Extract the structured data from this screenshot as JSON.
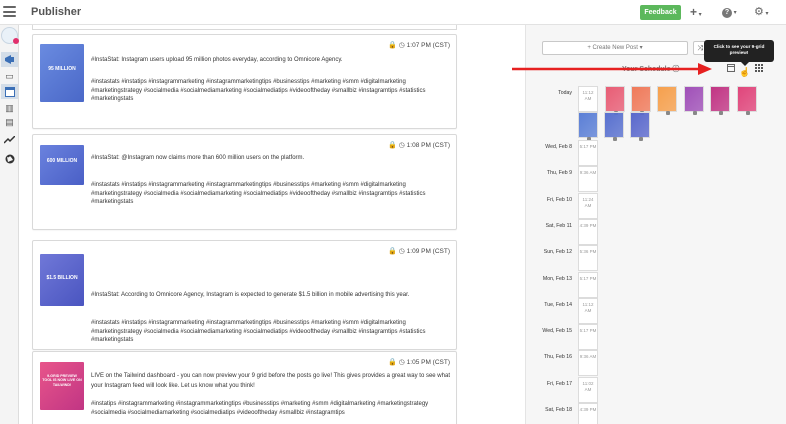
{
  "header": {
    "title": "Publisher",
    "feedback_label": "Feedback",
    "add_label": "+",
    "help_label": "?",
    "settings_label": "⚙"
  },
  "sidebar": {
    "items": [
      {
        "icon": "megaphone-icon"
      },
      {
        "icon": "inbox-icon"
      },
      {
        "icon": "calendar-icon"
      },
      {
        "icon": "building-icon"
      },
      {
        "icon": "document-icon"
      },
      {
        "icon": "trend-chart-icon"
      },
      {
        "icon": "globe-icon"
      }
    ]
  },
  "posts": [
    {
      "thumb_text": "95 MILLION",
      "thumb_color": "#5b7fd6",
      "time": "1:07 PM (CST)",
      "caption": "#InstaStat: Instagram users upload 95 million photos everyday, according to Omnicore Agency.",
      "tags": "#instastats #instatips #instagrammarketing #instagrammarketingtips #businesstips #marketing #smm #digitalmarketing #marketingstrategy #socialmedia #socialmediamarketing #socialmediatips #videooftheday #smallbiz #instagramtips #statistics #marketingstats"
    },
    {
      "thumb_text": "600 MILLION",
      "thumb_color": "#5870cf",
      "time": "1:08 PM (CST)",
      "caption": "#InstaStat: @Instagram now claims more than 600 million users on the platform.",
      "tags": "#instastats #instatips #instagrammarketing #instagrammarketingtips #businesstips #marketing #smm #digitalmarketing #marketingstrategy #socialmedia #socialmediamarketing #socialmediatips #videooftheday #smallbiz #instagramtips #statistics #marketingstats"
    },
    {
      "thumb_text": "$1.5 BILLION",
      "thumb_color": "#5a68cc",
      "time": "1:09 PM (CST)",
      "caption": "#InstaStat: According to Omnicore Agency, Instagram is expected to generate $1.5 billion in mobile advertising this year.",
      "tags": "#instastats #instatips #instagrammarketing #instagrammarketingtips #businesstips #marketing #smm #digitalmarketing #marketingstrategy #socialmedia #socialmediamarketing #socialmediatips #videooftheday #smallbiz #instagramtips #statistics #marketingstats"
    },
    {
      "thumb_text": "9-GRID PREVIEW TOOL IS NOW LIVE ON TAILWIND!",
      "thumb_color": "#e0457b",
      "time": "1:05 PM (CST)",
      "caption": "LIVE on the Tailwind dashboard - you can now preview your 9 grid before the posts go live! This gives provides a great way to see what your Instagram feed will look like. Let us know what you think!",
      "tags": "#instatips #instagrammarketing #instagrammarketingtips #businesstips #marketing #smm #digitalmarketing #marketingstrategy #socialmedia #socialmediamarketing #socialmediatips #videooftheday #smallbiz #instagramtips"
    }
  ],
  "schedule": {
    "create_label": "+ Create New Post ▾",
    "title": "Your Schedule ⓘ",
    "tooltip": "Click to see your 9-grid preview!",
    "today_label": "Today",
    "today_slot": "11:12 AM",
    "today_thumbs": [
      {
        "color": "#e85d75",
        "label": ""
      },
      {
        "color": "#f07a5a",
        "label": ""
      },
      {
        "color": "#f6a04d",
        "label": ""
      },
      {
        "color": "#a050b8",
        "label": ""
      },
      {
        "color": "#c13584",
        "label": ""
      },
      {
        "color": "#e0457b",
        "label": ""
      },
      {
        "color": "#5b7fd6",
        "label": ""
      },
      {
        "color": "#5870cf",
        "label": ""
      },
      {
        "color": "#5a68cc",
        "label": ""
      }
    ],
    "days": [
      {
        "label": "Wed, Feb 8",
        "slot": "5:17 PM"
      },
      {
        "label": "Thu, Feb 9",
        "slot": "9:36 AM"
      },
      {
        "label": "Fri, Feb 10",
        "slot": "11:24 AM"
      },
      {
        "label": "Sat, Feb 11",
        "slot": "4:39 PM"
      },
      {
        "label": "Sun, Feb 12",
        "slot": "5:36 PM"
      },
      {
        "label": "Mon, Feb 13",
        "slot": "5:17 PM"
      },
      {
        "label": "Tue, Feb 14",
        "slot": "11:12 AM"
      },
      {
        "label": "Wed, Feb 15",
        "slot": "5:17 PM"
      },
      {
        "label": "Thu, Feb 16",
        "slot": "9:36 AM"
      },
      {
        "label": "Fri, Feb 17",
        "slot": "11:02 AM"
      },
      {
        "label": "Sat, Feb 18",
        "slot": "4:39 PM"
      }
    ]
  }
}
